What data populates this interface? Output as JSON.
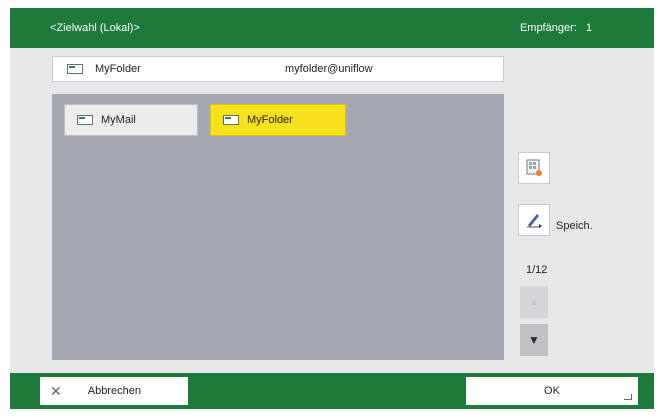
{
  "header": {
    "title": "<Zielwahl (Lokal)>",
    "recipients_label": "Empfänger:",
    "recipients_count": "1"
  },
  "selected_destination": {
    "name": "MyFolder",
    "address": "myfolder@uniflow",
    "icon": "address-entry-icon"
  },
  "entries": [
    {
      "label": "MyMail",
      "icon": "address-entry-icon",
      "selected": false
    },
    {
      "label": "MyFolder",
      "icon": "address-entry-icon",
      "selected": true
    }
  ],
  "side_panel": {
    "address_book_icon": "address-book-icon",
    "save_icon": "pen-save-icon",
    "save_label": "Speich.",
    "page_indicator": "1/12",
    "scroll_up_icon": "triangle-up-icon",
    "scroll_down_icon": "triangle-down-icon"
  },
  "footer": {
    "cancel_label": "Abbrechen",
    "ok_label": "OK"
  },
  "colors": {
    "bar_green": "#1d7a3b",
    "selected_yellow": "#f7e11c",
    "list_background": "#a3a8b2"
  }
}
